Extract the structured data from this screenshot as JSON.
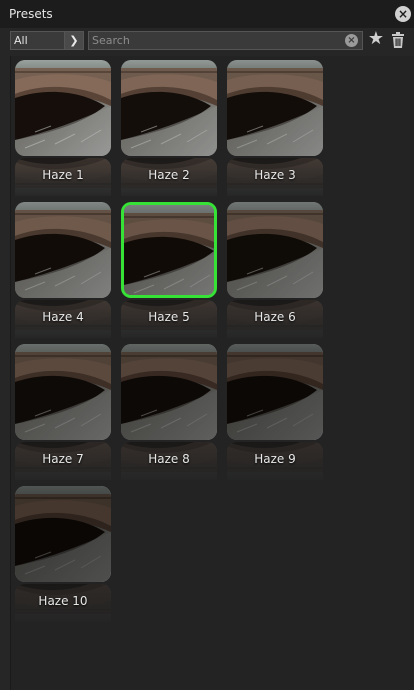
{
  "panel": {
    "title": "Presets",
    "close_icon": "close-icon"
  },
  "toolbar": {
    "filter": {
      "value": "All",
      "icon": "chevron-down-icon"
    },
    "search": {
      "placeholder": "Search",
      "value": "",
      "clear_icon": "clear-search-icon"
    },
    "favorite_icon": "star-icon",
    "delete_icon": "trash-icon"
  },
  "presets": [
    {
      "label": "Haze 1",
      "haze": 0.1,
      "selected": false
    },
    {
      "label": "Haze 2",
      "haze": 0.2,
      "selected": false
    },
    {
      "label": "Haze 3",
      "haze": 0.3,
      "selected": false
    },
    {
      "label": "Haze 4",
      "haze": 0.4,
      "selected": false
    },
    {
      "label": "Haze 5",
      "haze": 0.5,
      "selected": true
    },
    {
      "label": "Haze 6",
      "haze": 0.6,
      "selected": false
    },
    {
      "label": "Haze 7",
      "haze": 0.7,
      "selected": false
    },
    {
      "label": "Haze 8",
      "haze": 0.8,
      "selected": false
    },
    {
      "label": "Haze 9",
      "haze": 0.9,
      "selected": false
    },
    {
      "label": "Haze 10",
      "haze": 1.0,
      "selected": false
    }
  ],
  "colors": {
    "selection_border": "#37e237",
    "panel_bg": "#262626"
  }
}
